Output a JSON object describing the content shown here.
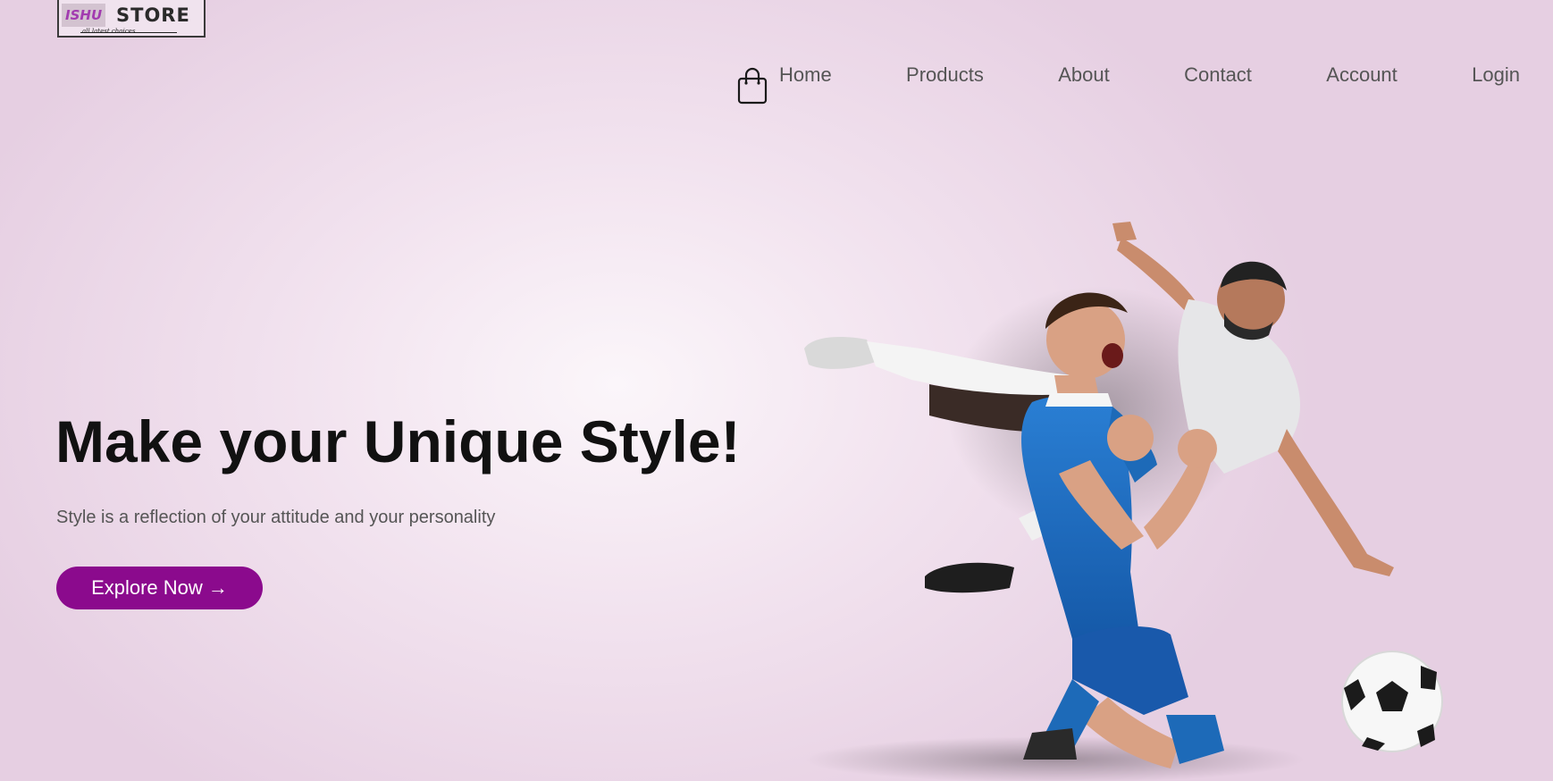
{
  "logo": {
    "brand": "ISHU",
    "word": "STORE",
    "tagline": "all latest choices"
  },
  "header": {
    "cart_icon": "shopping-bag-icon",
    "nav": [
      {
        "label": "Home"
      },
      {
        "label": "Products"
      },
      {
        "label": "About"
      },
      {
        "label": "Contact"
      },
      {
        "label": "Account"
      },
      {
        "label": "Login"
      }
    ]
  },
  "hero": {
    "title": "Make your Unique Style!",
    "subtitle": "Style is a reflection of your attitude and your personality",
    "cta_label": "Explore Now →"
  },
  "colors": {
    "accent": "#8b0a8d",
    "background": "#eddbe9",
    "nav_text": "#555555",
    "title_text": "#111111"
  }
}
